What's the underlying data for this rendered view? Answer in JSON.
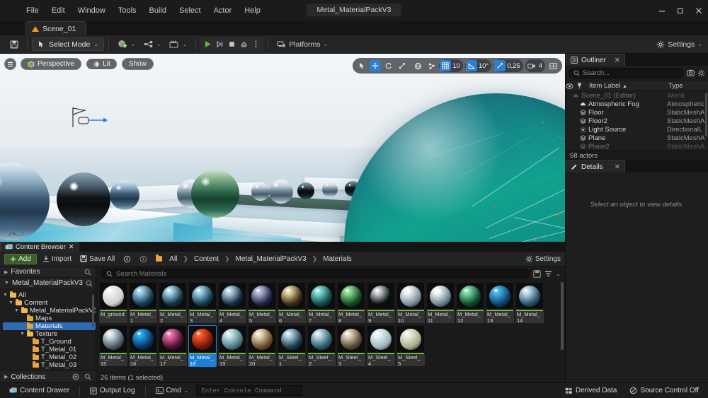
{
  "window": {
    "title": "Metal_MaterialPackV3",
    "minimize_label": "–",
    "maximize_label": "❐",
    "close_label": "✕"
  },
  "menubar": {
    "items": [
      "File",
      "Edit",
      "Window",
      "Tools",
      "Build",
      "Select",
      "Actor",
      "Help"
    ]
  },
  "level_tab": {
    "label": "Scene_01",
    "icon": "warning-triangle-icon"
  },
  "toolbar": {
    "save_icon": "save-icon",
    "mode_label": "Select Mode",
    "add_label": "add-actor-icon",
    "blueprint_label": "blueprint-icon",
    "cinematics_label": "cinematics-icon",
    "play_label": "▶",
    "skip_label": "⏵|",
    "stop_label": "■",
    "eject_label": "⏏",
    "more_label": "⋮",
    "platforms_label": "Platforms",
    "settings_label": "Settings"
  },
  "viewport": {
    "menu_icon": "viewport-menu-icon",
    "perspective_label": "Perspective",
    "lit_label": "Lit",
    "show_label": "Show",
    "tools": [
      "select-tool",
      "move-tool",
      "rotate-tool",
      "scale-tool"
    ],
    "active_tool_index": 1,
    "coord_icon": "world-coordinate-icon",
    "surface_snap_icon": "surface-snap-icon",
    "grid_snap_icon": "grid-snap-icon",
    "grid_snap_value": "10",
    "angle_snap_icon": "angle-snap-icon",
    "angle_snap_value": "10°",
    "scale_snap_icon": "scale-snap-icon",
    "scale_snap_value": "0,25",
    "camera_speed_icon": "camera-speed-icon",
    "camera_speed_value": "4",
    "maximize_icon": "maximize-viewport-icon",
    "axis_z": "Z",
    "axis_x": "X",
    "axis_y": "Y"
  },
  "outliner": {
    "tab_label": "Outliner",
    "close_label": "✕",
    "search_placeholder": "Search...",
    "columns": [
      "Item Label",
      "Type"
    ],
    "sort_indicator": "▲",
    "rows": [
      {
        "label": "Scene_01 (Editor)",
        "type": "World",
        "icon": "world-icon",
        "indent": 10,
        "dim": true
      },
      {
        "label": "Atmospheric Fog",
        "type": "Atmospheric",
        "icon": "fog-icon",
        "indent": 20,
        "dim": false
      },
      {
        "label": "Floor",
        "type": "StaticMeshA",
        "icon": "mesh-icon",
        "indent": 20,
        "dim": false
      },
      {
        "label": "Floor2",
        "type": "StaticMeshA",
        "icon": "mesh-icon",
        "indent": 20,
        "dim": false
      },
      {
        "label": "Light Source",
        "type": "DirectionalL",
        "icon": "light-icon",
        "indent": 20,
        "dim": false
      },
      {
        "label": "Plane",
        "type": "StaticMeshA",
        "icon": "mesh-icon",
        "indent": 20,
        "dim": false
      },
      {
        "label": "Plane2",
        "type": "StaticMeshA",
        "icon": "mesh-icon",
        "indent": 20,
        "dim": true
      }
    ],
    "status": "58 actors"
  },
  "details": {
    "tab_label": "Details",
    "close_label": "✕",
    "empty_message": "Select an object to view details."
  },
  "content_browser": {
    "tab_label": "Content Browser",
    "close_label": "✕",
    "add_label": "Add",
    "import_label": "Import",
    "save_all_label": "Save All",
    "nav_back_icon": "nav-back-icon",
    "nav_forward_icon": "nav-forward-icon",
    "breadcrumb": [
      "All",
      "Content",
      "Metal_MaterialPackV3",
      "Materials"
    ],
    "breadcrumb_sep": "❯",
    "settings_label": "Settings",
    "search_placeholder": "Search Materials",
    "save_search_icon": "save-search-icon",
    "filter_icon": "filter-icon",
    "filter_caret": "⌄",
    "sidebar": {
      "favorites_label": "Favorites",
      "root_label": "Metal_MaterialPackV3",
      "collections_label": "Collections",
      "tree": [
        {
          "label": "All",
          "depth": 0,
          "twisty": "▼",
          "selected": false
        },
        {
          "label": "Content",
          "depth": 1,
          "twisty": "▼",
          "selected": false
        },
        {
          "label": "Metal_MaterialPackV3",
          "depth": 2,
          "twisty": "▼",
          "selected": false
        },
        {
          "label": "Maps",
          "depth": 3,
          "twisty": "",
          "selected": false
        },
        {
          "label": "Materials",
          "depth": 3,
          "twisty": "",
          "selected": true
        },
        {
          "label": "Texture",
          "depth": 3,
          "twisty": "▼",
          "selected": false
        },
        {
          "label": "T_Ground",
          "depth": 4,
          "twisty": "",
          "selected": false
        },
        {
          "label": "T_Metal_01",
          "depth": 4,
          "twisty": "",
          "selected": false
        },
        {
          "label": "T_Metal_02",
          "depth": 4,
          "twisty": "",
          "selected": false
        },
        {
          "label": "T_Metal_03",
          "depth": 4,
          "twisty": "",
          "selected": false
        }
      ]
    },
    "status": "26 items (1 selected)",
    "assets": [
      {
        "name": "M_ground",
        "line1": "M_ground",
        "line2": "",
        "color": "#f2f2f2",
        "color2": "#cfcfcf",
        "selected": false
      },
      {
        "name": "M_Metal_1",
        "line1": "M_Metal_",
        "line2": "1",
        "color": "#9fd4ef",
        "color2": "#16384f",
        "selected": false
      },
      {
        "name": "M_Metal_2",
        "line1": "M_Metal_",
        "line2": "2",
        "color": "#a9dcef",
        "color2": "#123243",
        "selected": false
      },
      {
        "name": "M_Metal_3",
        "line1": "M_Metal_",
        "line2": "3",
        "color": "#a3d6ee",
        "color2": "#14384c",
        "selected": false
      },
      {
        "name": "M_Metal_4",
        "line1": "M_Metal_",
        "line2": "4",
        "color": "#b9d9ec",
        "color2": "#16293a",
        "selected": false
      },
      {
        "name": "M_Metal_5",
        "line1": "M_Metal_",
        "line2": "5",
        "color": "#b5bede",
        "color2": "#1d2340",
        "selected": false
      },
      {
        "name": "M_Metal_6",
        "line1": "M_Metal_",
        "line2": "6",
        "color": "#e6d6a8",
        "color2": "#3b2d11",
        "selected": false
      },
      {
        "name": "M_Metal_7",
        "line1": "M_Metal_",
        "line2": "7",
        "color": "#84e2d9",
        "color2": "#0d4a48",
        "selected": false
      },
      {
        "name": "M_Metal_8",
        "line1": "M_Metal_",
        "line2": "8",
        "color": "#8fe09a",
        "color2": "#114a23",
        "selected": false
      },
      {
        "name": "M_Metal_9",
        "line1": "M_Metal_",
        "line2": "9",
        "color": "#cfd9dd",
        "color2": "#0a0f12",
        "selected": false
      },
      {
        "name": "M_Metal_10",
        "line1": "M_Metal_",
        "line2": "10",
        "color": "#f4f8fa",
        "color2": "#7d8f9b",
        "selected": false
      },
      {
        "name": "M_Metal_11",
        "line1": "M_Metal_",
        "line2": "11",
        "color": "#f6fafc",
        "color2": "#6f8490",
        "selected": false
      },
      {
        "name": "M_Metal_12",
        "line1": "M_Metal_",
        "line2": "12",
        "color": "#7fe0a8",
        "color2": "#0e4a2c",
        "selected": false
      },
      {
        "name": "M_Metal_13",
        "line1": "M_Metal_",
        "line2": "13",
        "color": "#4ab9f0",
        "color2": "#0b4370",
        "selected": false
      },
      {
        "name": "M_Metal_14",
        "line1": "M_Metal_",
        "line2": "14",
        "color": "#c4e4f2",
        "color2": "#27506a",
        "selected": false
      },
      {
        "name": "M_Metal_15",
        "line1": "M_Metal_",
        "line2": "15",
        "color": "#dde8ee",
        "color2": "#4a5d6a",
        "selected": false
      },
      {
        "name": "M_Metal_16",
        "line1": "M_Metal_",
        "line2": "16",
        "color": "#29a8f5",
        "color2": "#063461",
        "selected": false
      },
      {
        "name": "M_Metal_17",
        "line1": "M_Metal_",
        "line2": "17",
        "color": "#f070a8",
        "color2": "#4d0f33",
        "selected": false
      },
      {
        "name": "M_Metal_18",
        "line1": "M_Metal_",
        "line2": "18",
        "color": "#ff5a2a",
        "color2": "#7a1405",
        "selected": true
      },
      {
        "name": "M_Metal_19",
        "line1": "M_Metal_",
        "line2": "19",
        "color": "#cfeaf0",
        "color2": "#4c7b83",
        "selected": false
      },
      {
        "name": "M_Metal_20",
        "line1": "M_Metal_",
        "line2": "20",
        "color": "#efe0c4",
        "color2": "#6a4f27",
        "selected": false
      },
      {
        "name": "M_Steel_1",
        "line1": "M_Steel_",
        "line2": "1",
        "color": "#bfdce8",
        "color2": "#1b3b4c",
        "selected": false
      },
      {
        "name": "M_Steel_2",
        "line1": "M_Steel_",
        "line2": "2",
        "color": "#c8e2ea",
        "color2": "#2a5c6b",
        "selected": false
      },
      {
        "name": "M_Steel_3",
        "line1": "M_Steel_",
        "line2": "3",
        "color": "#e7dcc9",
        "color2": "#5a4a33",
        "selected": false
      },
      {
        "name": "M_Steel_4",
        "line1": "M_Steel_",
        "line2": "4",
        "color": "#eaf4f8",
        "color2": "#9fb6bf",
        "selected": false
      },
      {
        "name": "M_Steel_5",
        "line1": "M_Steel_",
        "line2": "5",
        "color": "#eef0e0",
        "color2": "#a8ad8a",
        "selected": false
      }
    ]
  },
  "statusbar": {
    "content_drawer_label": "Content Drawer",
    "output_log_label": "Output Log",
    "cmd_label": "Cmd",
    "cmd_caret": "⌄",
    "console_placeholder": "Enter Console Command",
    "derived_data_label": "Derived Data",
    "source_control_label": "Source Control Off"
  },
  "colors": {
    "accent_blue": "#1e7fd4",
    "accent_green": "#6db33f",
    "add_button_green": "#3c5c2e",
    "selection_blue": "#2d6bb5",
    "panel_bg": "#1b1b1b",
    "toolbar_bg": "#242424"
  }
}
